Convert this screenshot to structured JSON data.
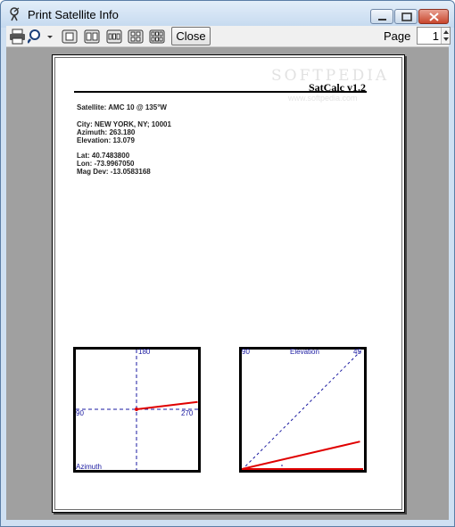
{
  "window": {
    "title": "Print Satellite Info",
    "title_icon": "satellite-dish-icon"
  },
  "toolbar": {
    "icons": [
      "printer-icon",
      "zoom-icon",
      "dropdown-arrow-icon",
      "one-page-icon",
      "two-pages-icon",
      "three-pages-icon",
      "four-pages-icon",
      "six-pages-icon"
    ],
    "close_label": "Close",
    "page_label": "Page",
    "page_value": "1"
  },
  "document": {
    "watermark": "SOFTPEDIA",
    "watermark_url": "www.softpedia.com",
    "app_version": "SatCalc v1.2",
    "satellite_line": "Satellite: AMC 10 @ 135°W",
    "city_line": "City: NEW YORK, NY;  10001",
    "azimuth_line": "Azimuth: 263.180",
    "elevation_line": "Elevation: 13.079",
    "lat_line": "Lat: 40.7483800",
    "lon_line": "Lon: -73.9967050",
    "magdev_line": "Mag Dev: -13.0583168"
  },
  "azimuth_plot": {
    "label_top": "180",
    "label_left": "90",
    "label_right": "270",
    "label_bottom": "Azimuth",
    "azimuth_deg": 263.18
  },
  "elevation_plot": {
    "label_left": "90",
    "label_title": "Elevation",
    "label_right": "45",
    "elevation_deg": 13.079
  },
  "colors": {
    "indicator": "#e00000",
    "guide": "#1a1aa0",
    "frame": "#000000"
  }
}
